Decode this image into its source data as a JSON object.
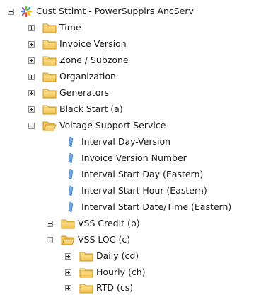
{
  "tree": {
    "root": {
      "label": "Cust Sttlmt - PowerSupplrs AncServ",
      "icon": "cube-star-icon"
    },
    "time": {
      "label": "Time",
      "icon": "folder-icon"
    },
    "invoice_version": {
      "label": "Invoice Version",
      "icon": "folder-icon"
    },
    "zone_subzone": {
      "label": "Zone / Subzone",
      "icon": "folder-icon"
    },
    "organization": {
      "label": "Organization",
      "icon": "folder-icon"
    },
    "generators": {
      "label": "Generators",
      "icon": "folder-icon"
    },
    "black_start": {
      "label": "Black Start (a)",
      "icon": "folder-icon"
    },
    "voltage_support": {
      "label": "Voltage Support Service",
      "icon": "folder-open-icon",
      "fields": [
        {
          "label": "Interval Day-Version",
          "icon": "field-icon"
        },
        {
          "label": "Invoice Version Number",
          "icon": "field-icon"
        },
        {
          "label": "Interval Start Day (Eastern)",
          "icon": "field-icon"
        },
        {
          "label": "Interval Start Hour (Eastern)",
          "icon": "field-icon"
        },
        {
          "label": "Interval Start Date/Time (Eastern)",
          "icon": "field-icon"
        }
      ],
      "vss_credit": {
        "label": "VSS Credit (b)",
        "icon": "folder-icon"
      },
      "vss_loc": {
        "label": "VSS LOC (c)",
        "icon": "folder-open-icon",
        "daily": {
          "label": "Daily (cd)",
          "icon": "folder-icon"
        },
        "hourly": {
          "label": "Hourly (ch)",
          "icon": "folder-icon"
        },
        "rtd": {
          "label": "RTD (cs)",
          "icon": "folder-icon"
        }
      }
    }
  },
  "colors": {
    "folder": "#f5c542",
    "folder_edge": "#c9961c",
    "field": "#4a90e2"
  }
}
